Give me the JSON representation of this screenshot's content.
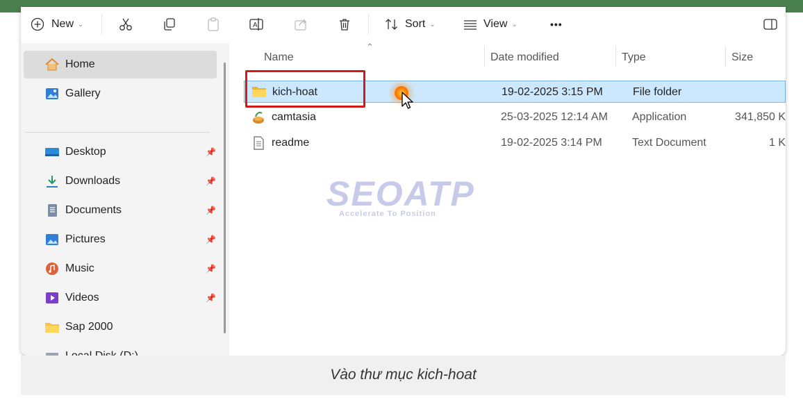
{
  "toolbar": {
    "new_label": "New",
    "sort_label": "Sort",
    "view_label": "View",
    "more_label": "•••"
  },
  "sidebar": {
    "items": [
      {
        "label": "Home",
        "icon": "home-icon",
        "pinned": false
      },
      {
        "label": "Gallery",
        "icon": "gallery-icon",
        "pinned": false
      },
      {
        "label": "Desktop",
        "icon": "desktop-icon",
        "pinned": true
      },
      {
        "label": "Downloads",
        "icon": "download-icon",
        "pinned": true
      },
      {
        "label": "Documents",
        "icon": "documents-icon",
        "pinned": true
      },
      {
        "label": "Pictures",
        "icon": "pictures-icon",
        "pinned": true
      },
      {
        "label": "Music",
        "icon": "music-icon",
        "pinned": true
      },
      {
        "label": "Videos",
        "icon": "videos-icon",
        "pinned": true
      },
      {
        "label": "Sap 2000",
        "icon": "folder-icon",
        "pinned": false
      },
      {
        "label": "Local Disk (D:)",
        "icon": "drive-icon",
        "pinned": false
      }
    ]
  },
  "list": {
    "columns": [
      "Name",
      "Date modified",
      "Type",
      "Size"
    ],
    "rows": [
      {
        "name": "kich-hoat",
        "date": "19-02-2025 3:15 PM",
        "type": "File folder",
        "size": "",
        "icon": "folder-icon",
        "selected": true
      },
      {
        "name": "camtasia",
        "date": "25-03-2025 12:14 AM",
        "type": "Application",
        "size": "341,850 K",
        "icon": "app-icon",
        "selected": false
      },
      {
        "name": "readme",
        "date": "19-02-2025 3:14 PM",
        "type": "Text Document",
        "size": "1 K",
        "icon": "text-file-icon",
        "selected": false
      }
    ]
  },
  "watermark": {
    "brand": "SEOATP",
    "tagline": "Accelerate To Position"
  },
  "caption": "Vào thư mục kich-hoat",
  "colors": {
    "accent_bar": "#4a7f4e",
    "selection": "#cce8ff",
    "highlight_box": "#d11a1a"
  }
}
